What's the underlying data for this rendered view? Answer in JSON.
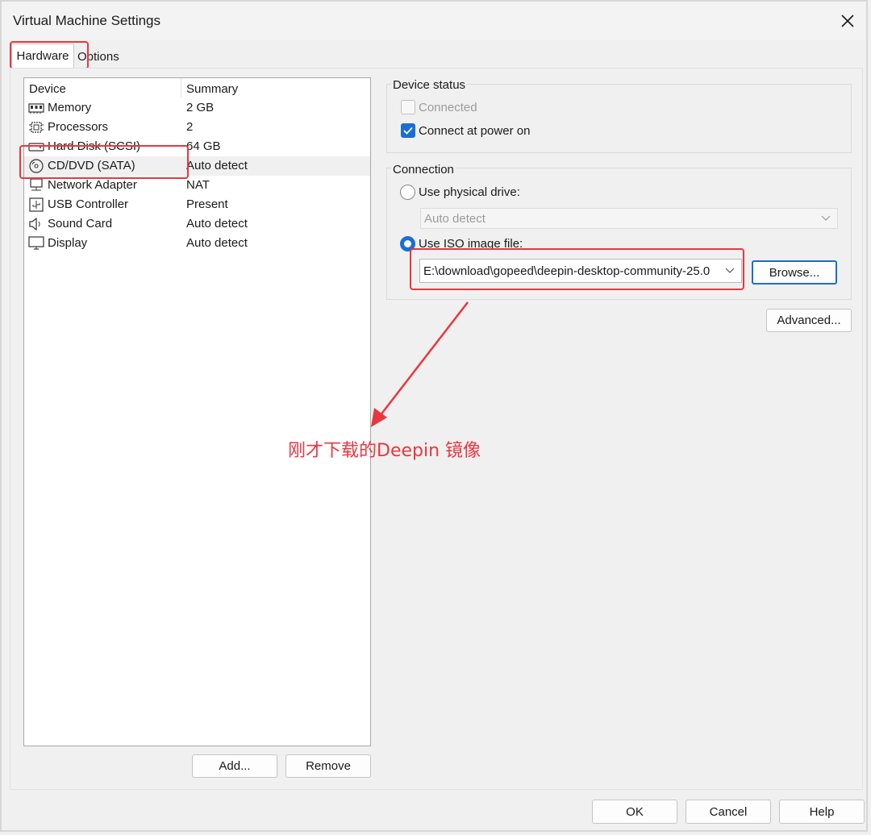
{
  "window": {
    "title": "Virtual Machine Settings"
  },
  "tabs": [
    {
      "label": "Hardware",
      "active": true
    },
    {
      "label": "Options",
      "active": false
    }
  ],
  "device_list": {
    "columns": [
      "Device",
      "Summary"
    ],
    "rows": [
      {
        "icon": "memory-icon",
        "device": "Memory",
        "summary": "2 GB",
        "selected": false
      },
      {
        "icon": "processor-icon",
        "device": "Processors",
        "summary": "2",
        "selected": false
      },
      {
        "icon": "hard-disk-icon",
        "device": "Hard Disk (SCSI)",
        "summary": "64 GB",
        "selected": false
      },
      {
        "icon": "cd-dvd-icon",
        "device": "CD/DVD (SATA)",
        "summary": "Auto detect",
        "selected": true
      },
      {
        "icon": "network-adapter-icon",
        "device": "Network Adapter",
        "summary": "NAT",
        "selected": false
      },
      {
        "icon": "usb-icon",
        "device": "USB Controller",
        "summary": "Present",
        "selected": false
      },
      {
        "icon": "sound-card-icon",
        "device": "Sound Card",
        "summary": "Auto detect",
        "selected": false
      },
      {
        "icon": "display-icon",
        "device": "Display",
        "summary": "Auto detect",
        "selected": false
      }
    ],
    "add_label": "Add...",
    "remove_label": "Remove"
  },
  "device_status": {
    "label": "Device status",
    "connected_label": "Connected",
    "connected_checked": false,
    "connect_power_label": "Connect at power on",
    "connect_power_checked": true
  },
  "connection": {
    "label": "Connection",
    "physical_label": "Use physical drive:",
    "physical_selected": false,
    "physical_value": "Auto detect",
    "iso_label": "Use ISO image file:",
    "iso_selected": true,
    "iso_value": "E:\\download\\gopeed\\deepin-desktop-community-25.0",
    "browse_label": "Browse..."
  },
  "advanced_label": "Advanced...",
  "footer": {
    "ok_label": "OK",
    "cancel_label": "Cancel",
    "help_label": "Help"
  },
  "annotation": {
    "text": "刚才下载的Deepin 镜像",
    "color": "#e8373f"
  },
  "colors": {
    "accent": "#1a6fd0",
    "highlight": "#e8373f"
  }
}
